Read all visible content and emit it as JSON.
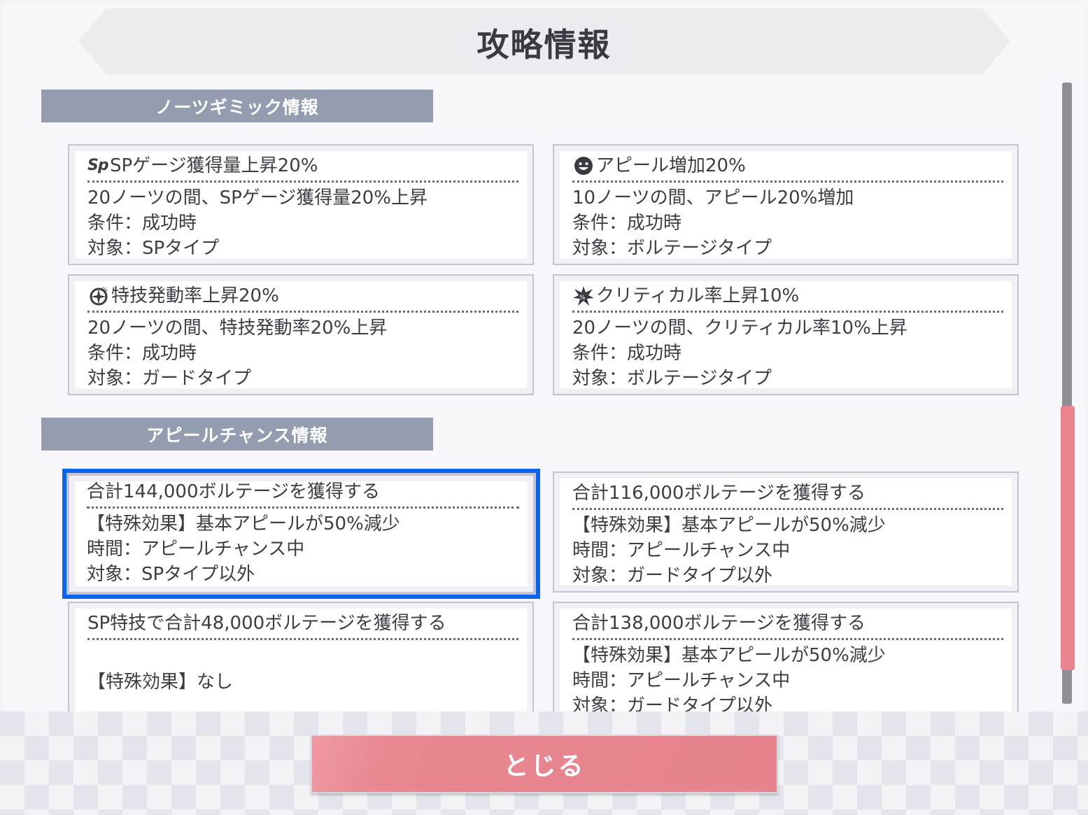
{
  "header": {
    "title": "攻略情報"
  },
  "sections": {
    "gimmick": {
      "title": "ノーツギミック情報",
      "cards": [
        {
          "icon_label": "Sp",
          "icon": "sp-gauge-icon",
          "title": "SPゲージ獲得量上昇20%",
          "lines": [
            "20ノーツの間、SPゲージ獲得量20%上昇",
            "条件：成功時",
            "対象：SPタイプ"
          ]
        },
        {
          "icon": "smile-icon",
          "title": "アピール増加20%",
          "lines": [
            "10ノーツの間、アピール20%増加",
            "条件：成功時",
            "対象：ボルテージタイプ"
          ]
        },
        {
          "icon": "skill-rate-icon",
          "title": "特技発動率上昇20%",
          "lines": [
            "20ノーツの間、特技発動率20%上昇",
            "条件：成功時",
            "対象：ガードタイプ"
          ]
        },
        {
          "icon": "critical-burst-icon",
          "title": "クリティカル率上昇10%",
          "lines": [
            "20ノーツの間、クリティカル率10%上昇",
            "条件：成功時",
            "対象：ボルテージタイプ"
          ]
        }
      ]
    },
    "appeal": {
      "title": "アピールチャンス情報",
      "cards": [
        {
          "title": "合計144,000ボルテージを獲得する",
          "lines": [
            "【特殊効果】基本アピールが50%減少",
            "時間：アピールチャンス中",
            "対象：SPタイプ以外"
          ]
        },
        {
          "title": "合計116,000ボルテージを獲得する",
          "lines": [
            "【特殊効果】基本アピールが50%減少",
            "時間：アピールチャンス中",
            "対象：ガードタイプ以外"
          ]
        },
        {
          "title": "SP特技で合計48,000ボルテージを獲得する",
          "lines": [
            "【特殊効果】なし"
          ]
        },
        {
          "title": "合計138,000ボルテージを獲得する",
          "lines": [
            "【特殊効果】基本アピールが50%減少",
            "時間：アピールチャンス中",
            "対象：ガードタイプ以外"
          ]
        }
      ]
    }
  },
  "footer": {
    "close_label": "とじる"
  },
  "colors": {
    "accent": "#e6838d",
    "selection": "#0a64f0",
    "section_header": "#939daf"
  }
}
